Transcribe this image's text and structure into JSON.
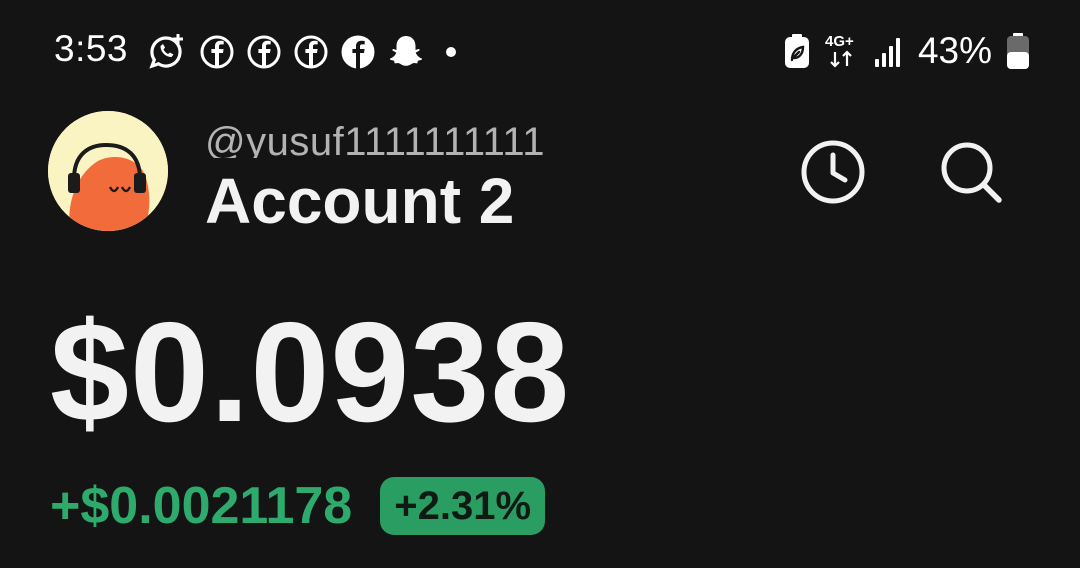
{
  "status_bar": {
    "time": "3:53",
    "notification_icons": [
      "whatsapp-icon",
      "facebook-icon",
      "facebook-icon",
      "facebook-icon",
      "facebook-icon",
      "snapchat-icon",
      "dot-icon"
    ],
    "network": "4G+",
    "battery_percent": "43%"
  },
  "header": {
    "handle": "@yusuf1111111111",
    "account_name": "Account 2",
    "icons": [
      "history-icon",
      "search-icon"
    ]
  },
  "balance": {
    "amount": "$0.0938",
    "change_amount": "+$0.0021178",
    "change_percent": "+2.31%"
  },
  "colors": {
    "background": "#141414",
    "positive": "#2eaa6c",
    "badge": "#2a9d63",
    "avatar_bg": "#f9f4c2",
    "avatar_face": "#f26b3a"
  }
}
